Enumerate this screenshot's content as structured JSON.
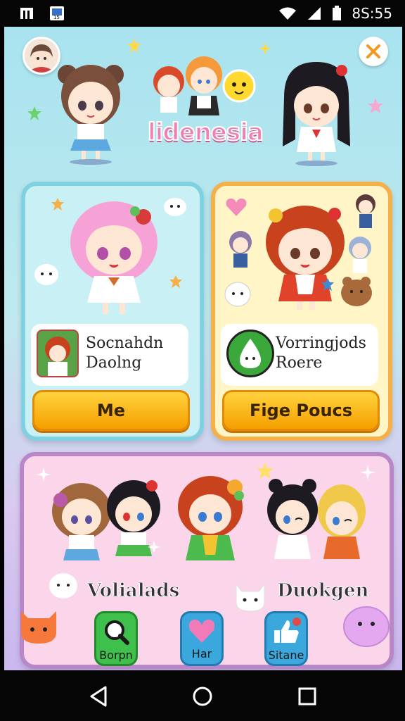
{
  "status_bar": {
    "time": "8S:55"
  },
  "header": {
    "app_title": "lidenesia"
  },
  "cards": [
    {
      "title_line1": "Socnahdn",
      "title_line2": "Daolng",
      "button_label": "Me"
    },
    {
      "title_line1": "Vorringjods",
      "title_line2": "Roere",
      "button_label": "Fige Poucs"
    }
  ],
  "group_card": {
    "label_left": "Volialads",
    "label_right": "Duokgen"
  },
  "bottom_nav": [
    {
      "label": "Borpn",
      "icon": "search-icon"
    },
    {
      "label": "Har",
      "icon": "heart-icon"
    },
    {
      "label": "Sitane",
      "icon": "thumbs-up-icon"
    }
  ],
  "colors": {
    "accent_orange": "#f5a000",
    "title_pink": "#f07fb6",
    "card_blue_border": "#7fd1e2",
    "card_yellow_border": "#f6b04a",
    "card_pink_border": "#b986c8"
  }
}
